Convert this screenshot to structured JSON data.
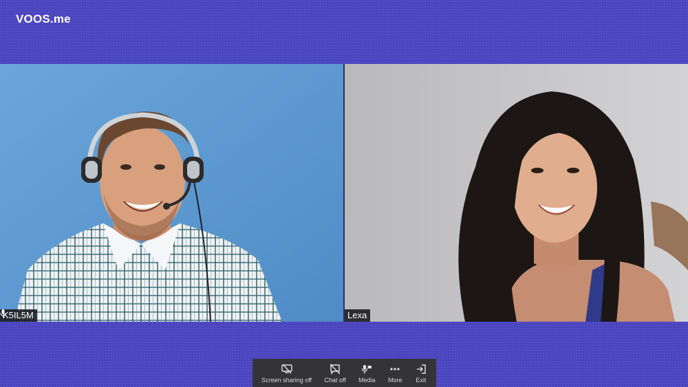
{
  "app": {
    "logo_text": "VOOS.me"
  },
  "participants": [
    {
      "name": "K5IL5M",
      "mic": "mic-icon",
      "background": "#5f9ed3"
    },
    {
      "name": "Lexa",
      "background": "#c5c5c7"
    }
  ],
  "toolbar": {
    "items": [
      {
        "label": "Screen sharing off",
        "icon": "screen-share-off-icon"
      },
      {
        "label": "Chat off",
        "icon": "chat-off-icon"
      },
      {
        "label": "Media",
        "icon": "media-icon"
      },
      {
        "label": "More",
        "icon": "more-dots-icon"
      },
      {
        "label": "Exit",
        "icon": "exit-icon"
      }
    ]
  },
  "colors": {
    "page_background": "#4a44bf",
    "toolbar_background": "#343436",
    "name_tag_background": "#141418"
  }
}
